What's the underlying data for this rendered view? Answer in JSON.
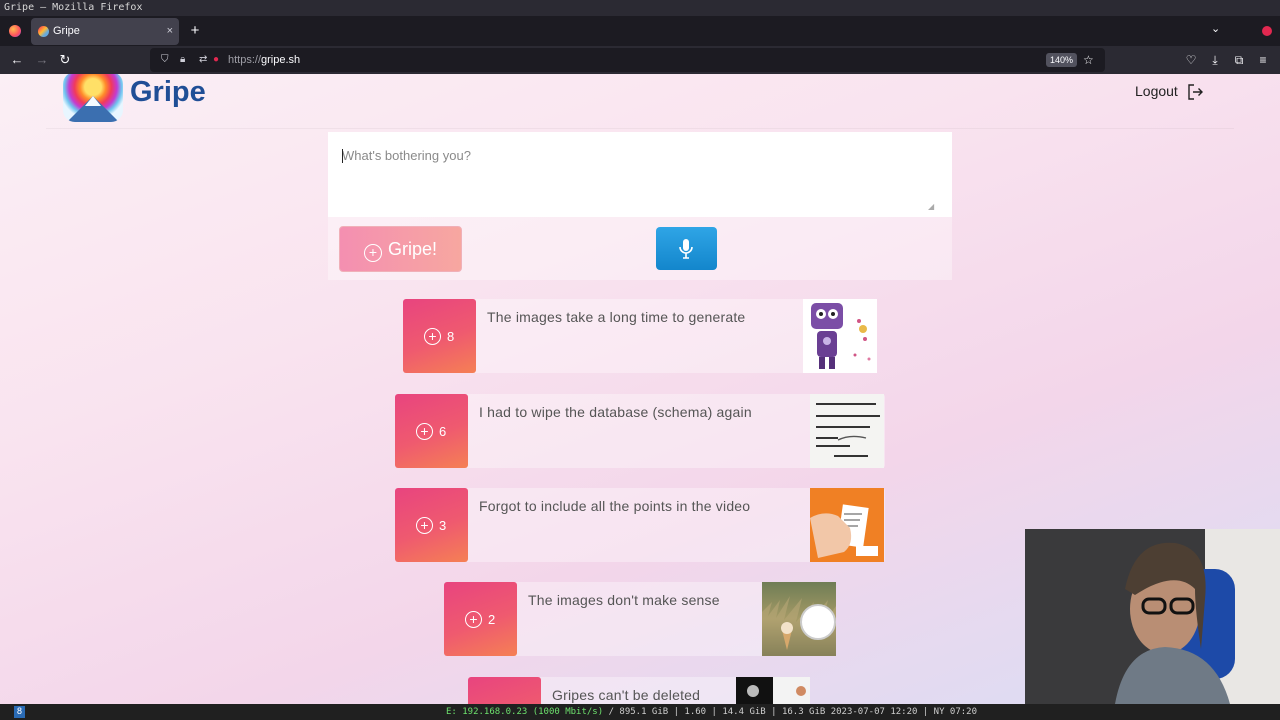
{
  "window": {
    "title": "Gripe — Mozilla Firefox"
  },
  "tabs": [
    {
      "label": "Gripe"
    }
  ],
  "tab_close_glyph": "×",
  "new_tab_glyph": "+",
  "url": {
    "scheme": "https://",
    "host": "gripe.sh",
    "zoom": "140%"
  },
  "site": {
    "brand": "Gripe",
    "logout": "Logout"
  },
  "composer": {
    "placeholder": "What's bothering you?",
    "submit_label": "Gripe!"
  },
  "gripes": [
    {
      "votes": "8",
      "text": "The images take a long time to generate",
      "thumb": "purple-robot"
    },
    {
      "votes": "6",
      "text": "I had to wipe the database (schema) again",
      "thumb": "whiteboard-text"
    },
    {
      "votes": "3",
      "text": "Forgot to include all the points in the video",
      "thumb": "hand-paper-orange"
    },
    {
      "votes": "2",
      "text": "The images don't make sense",
      "thumb": "field-ice-cream"
    },
    {
      "votes": "",
      "text": "Gripes can't be deleted",
      "thumb": "dark-photo"
    }
  ],
  "statusbar": {
    "workspace": "8",
    "net_label": "E: 192.168.0.23 (1000 Mbit/s)",
    "stats": "/ 895.1 GiB | 1.60 | 14.4 GiB | 16.3 GiB 2023-07-07 12:20 | NY 07:20"
  },
  "colors": {
    "accent_pink": "#e8447f",
    "accent_orange": "#f58054",
    "brand_blue": "#1f4e96",
    "mic_blue": "#1386cc"
  }
}
